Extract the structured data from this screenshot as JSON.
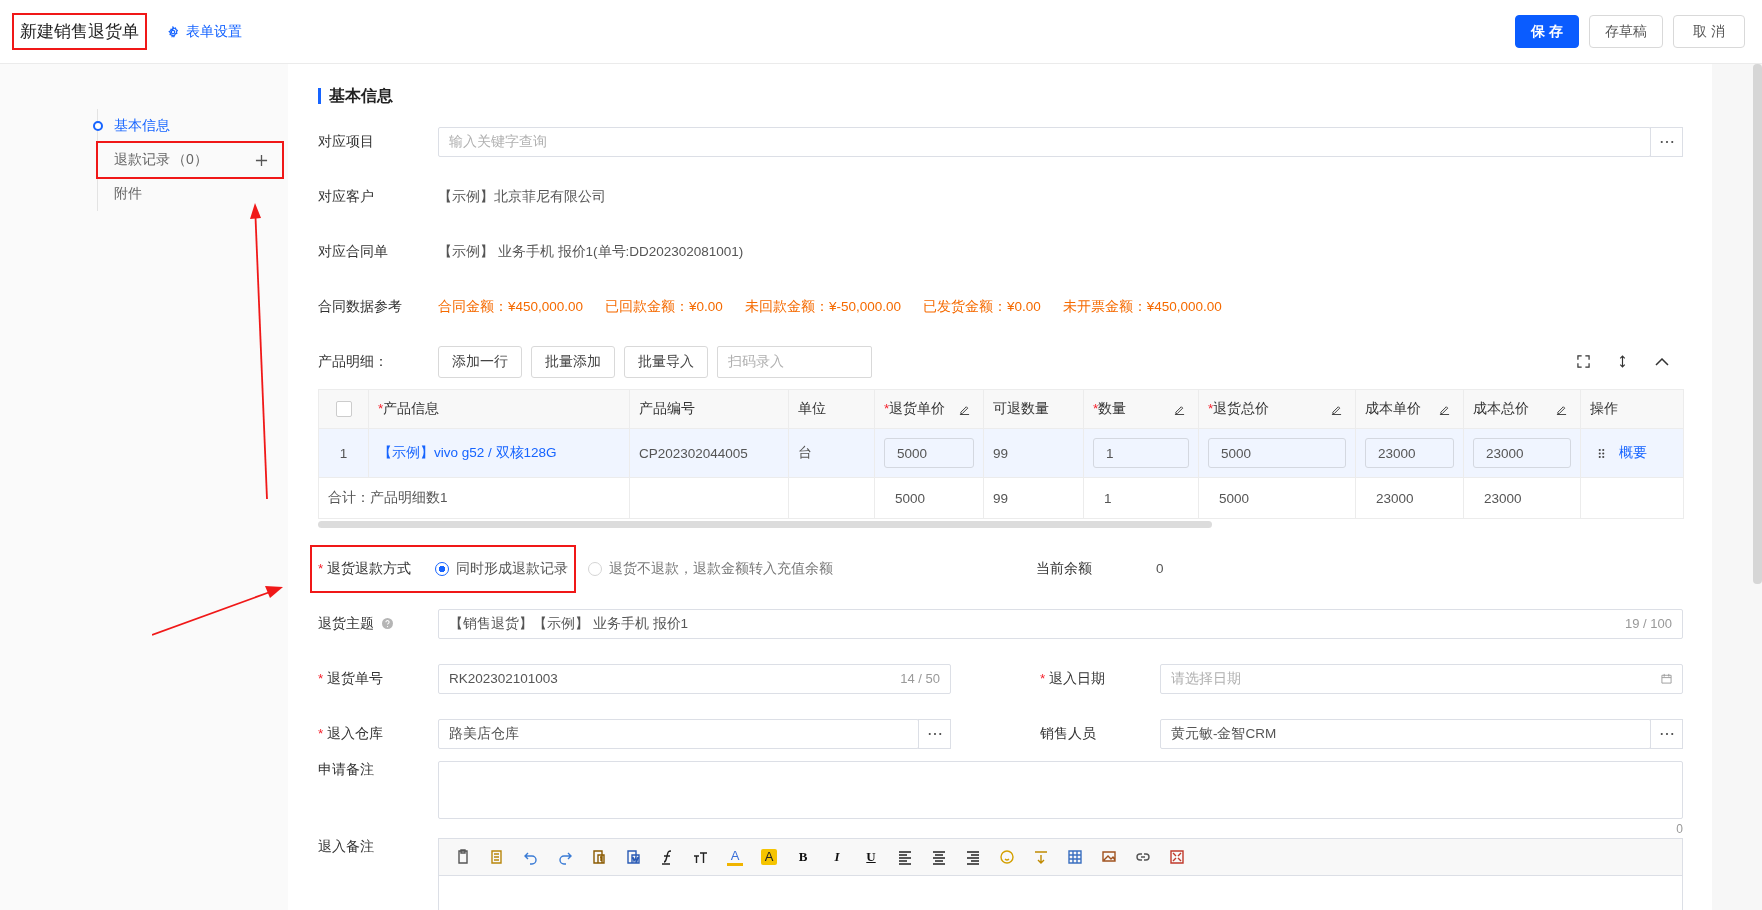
{
  "header": {
    "title": "新建销售退货单",
    "title_highlighted": true,
    "settings_link": "表单设置",
    "buttons": [
      {
        "label": "保 存",
        "kind": "primary"
      },
      {
        "label": "存草稿",
        "kind": "default"
      },
      {
        "label": "取 消",
        "kind": "default"
      }
    ]
  },
  "sidebar": {
    "items": [
      {
        "label": "基本信息",
        "selected": true,
        "highlighted": false
      },
      {
        "label": "退款记录",
        "count": "（0）",
        "selected": false,
        "highlighted": true
      },
      {
        "label": "附件",
        "selected": false,
        "highlighted": false
      }
    ]
  },
  "section_title": "基本信息",
  "project": {
    "label": "对应项目",
    "placeholder": "输入关键字查询"
  },
  "customer": {
    "label": "对应客户",
    "value": "【示例】北京菲尼有限公司"
  },
  "contract": {
    "label": "对应合同单",
    "value": "【示例】 业务手机 报价1(单号:DD202302081001)"
  },
  "contract_ref": {
    "label": "合同数据参考",
    "amounts": [
      "合同金额：¥450,000.00",
      "已回款金额：¥0.00",
      "未回款金额：¥-50,000.00",
      "已发货金额：¥0.00",
      "未开票金额：¥450,000.00"
    ]
  },
  "product_detail": {
    "label": "产品明细：",
    "buttons": [
      "添加一行",
      "批量添加",
      "批量导入"
    ],
    "scan_placeholder": "扫码录入"
  },
  "table": {
    "header_checkbox": {
      "checked": false
    },
    "columns": [
      {
        "label": "产品信息",
        "required_mark": "*"
      },
      {
        "label": "产品编号"
      },
      {
        "label": "单位"
      },
      {
        "label": "退货单价",
        "required_mark": "*",
        "editable": true
      },
      {
        "label": "可退数量"
      },
      {
        "label": "数量",
        "required_mark": "*",
        "editable": true
      },
      {
        "label": "退货总价",
        "required_mark": "*",
        "editable": true
      },
      {
        "label": "成本单价",
        "editable": true
      },
      {
        "label": "成本总价",
        "editable": true
      },
      {
        "label": "操作"
      }
    ],
    "rows": [
      {
        "index": "1",
        "highlighted": true,
        "cells": [
          {
            "kind": "link",
            "text": "【示例】vivo g52 / 双核128G"
          },
          {
            "kind": "text",
            "text": "CP202302044005"
          },
          {
            "kind": "text",
            "text": "台"
          },
          {
            "kind": "input",
            "text": "5000"
          },
          {
            "kind": "text",
            "text": "99"
          },
          {
            "kind": "input",
            "text": "1"
          },
          {
            "kind": "input",
            "text": "5000"
          },
          {
            "kind": "input",
            "text": "23000"
          },
          {
            "kind": "input",
            "text": "23000"
          },
          {
            "kind": "ops",
            "text": "概要"
          }
        ]
      }
    ],
    "total": {
      "label": "合计：产品明细数1",
      "cells": [
        "",
        "",
        "5000",
        "99",
        "1",
        "5000",
        "23000",
        "23000",
        ""
      ]
    }
  },
  "refund_method": {
    "label": "退货退款方式",
    "required_mark": "*",
    "highlighted": true,
    "options": [
      {
        "label": "同时形成退款记录",
        "selected": true
      },
      {
        "label": "退货不退款，退款金额转入充值余额",
        "selected": false
      }
    ],
    "balance_label": "当前余额",
    "balance_value": "0"
  },
  "subject": {
    "label": "退货主题",
    "value": "【销售退货】【示例】 业务手机 报价1",
    "counter": "19 / 100"
  },
  "order_no": {
    "label": "退货单号",
    "required_mark": "*",
    "value": "RK202302101003",
    "counter": "14 / 50"
  },
  "in_date": {
    "label": "退入日期",
    "required_mark": "*",
    "placeholder": "请选择日期"
  },
  "warehouse": {
    "label": "退入仓库",
    "required_mark": "*",
    "value": "路美店仓库"
  },
  "salesperson": {
    "label": "销售人员",
    "value": "黄元敏-金智CRM"
  },
  "apply_note": {
    "label": "申请备注",
    "counter": "0"
  },
  "in_note": {
    "label": "退入备注",
    "toolbar": [
      {
        "kind": "paste"
      },
      {
        "kind": "copy"
      },
      {
        "kind": "undo"
      },
      {
        "kind": "redo"
      },
      {
        "kind": "paste-text"
      },
      {
        "kind": "paste-word"
      },
      {
        "kind": "font"
      },
      {
        "kind": "font-size"
      },
      {
        "kind": "font-color",
        "text": "A"
      },
      {
        "kind": "highlight",
        "text": "A"
      },
      {
        "kind": "bold",
        "text": "B"
      },
      {
        "kind": "italic",
        "text": "I"
      },
      {
        "kind": "underline",
        "text": "U"
      },
      {
        "kind": "align-left"
      },
      {
        "kind": "align-center"
      },
      {
        "kind": "align-right"
      },
      {
        "kind": "emoji"
      },
      {
        "kind": "rule"
      },
      {
        "kind": "table"
      },
      {
        "kind": "image"
      },
      {
        "kind": "link"
      },
      {
        "kind": "fullscreen"
      }
    ]
  }
}
